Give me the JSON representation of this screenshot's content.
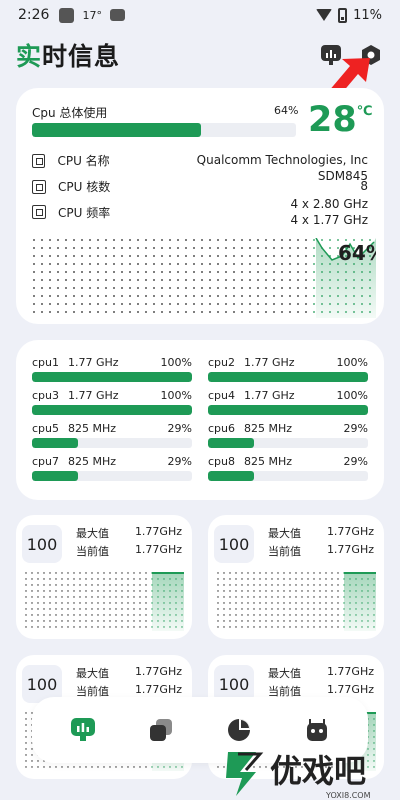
{
  "status_bar": {
    "time": "2:26",
    "temp": "17°",
    "battery": "11%"
  },
  "header": {
    "title_accent": "实",
    "title_rest": "时信息",
    "icons": [
      "chart-icon",
      "settings-hexagon-icon"
    ]
  },
  "colors": {
    "accent": "#1e9a56",
    "arrow": "#ee2222",
    "background": "#eef0f7"
  },
  "cpu": {
    "usage_label": "Cpu 总体使用",
    "usage_percent_text": "64%",
    "usage_value": 64,
    "temperature_value": "28",
    "temperature_unit": "℃",
    "name_label": "CPU 名称",
    "name_value": "Qualcomm Technologies, Inc SDM845",
    "cores_label": "CPU 核数",
    "cores_value": "8",
    "freq_label": "CPU 频率",
    "freq_line1": "4 x 2.80 GHz",
    "freq_line2": "4 x 1.77 GHz",
    "graph_percent": "64%"
  },
  "cores": [
    {
      "name": "cpu1",
      "freq": "1.77 GHz",
      "pct": "100%",
      "value": 100
    },
    {
      "name": "cpu2",
      "freq": "1.77 GHz",
      "pct": "100%",
      "value": 100
    },
    {
      "name": "cpu3",
      "freq": "1.77 GHz",
      "pct": "100%",
      "value": 100
    },
    {
      "name": "cpu4",
      "freq": "1.77 GHz",
      "pct": "100%",
      "value": 100
    },
    {
      "name": "cpu5",
      "freq": "825 MHz",
      "pct": "29%",
      "value": 29
    },
    {
      "name": "cpu6",
      "freq": "825 MHz",
      "pct": "29%",
      "value": 29
    },
    {
      "name": "cpu7",
      "freq": "825 MHz",
      "pct": "29%",
      "value": 29
    },
    {
      "name": "cpu8",
      "freq": "825 MHz",
      "pct": "29%",
      "value": 29
    }
  ],
  "freq_cards": [
    {
      "badge": "100",
      "max_label": "最大值",
      "max_value": "1.77GHz",
      "cur_label": "当前值",
      "cur_value": "1.77GHz"
    },
    {
      "badge": "100",
      "max_label": "最大值",
      "max_value": "1.77GHz",
      "cur_label": "当前值",
      "cur_value": "1.77GHz"
    },
    {
      "badge": "100",
      "max_label": "最大值",
      "max_value": "1.77GHz",
      "cur_label": "当前值",
      "cur_value": "1.77GHz"
    },
    {
      "badge": "100",
      "max_label": "最大值",
      "max_value": "1.77GHz",
      "cur_label": "当前值",
      "cur_value": "1.77GHz"
    }
  ],
  "nav": {
    "items": [
      "realtime-chart-icon",
      "cards-stack-icon",
      "pie-chart-icon",
      "android-robot-icon"
    ]
  },
  "watermark": {
    "text": "优戏吧",
    "url": "YOXI8.COM"
  }
}
